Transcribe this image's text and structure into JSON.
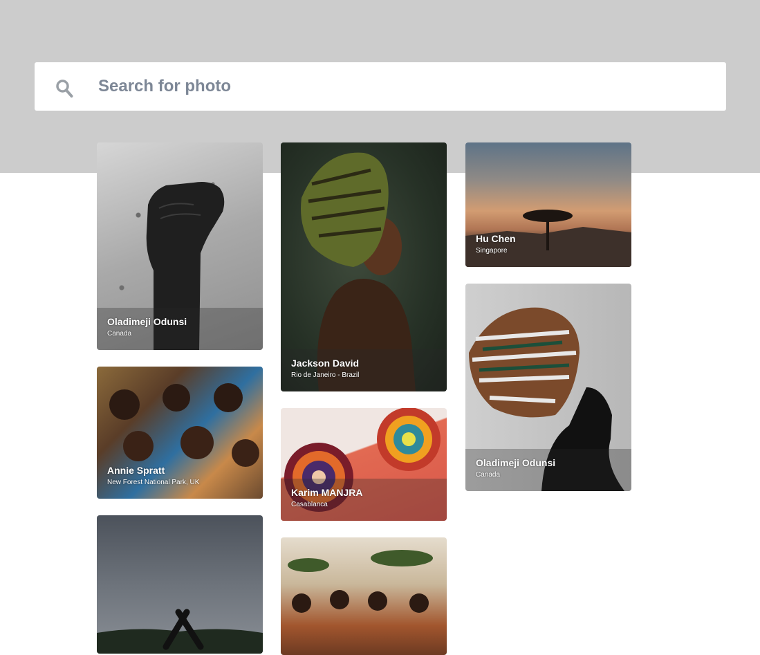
{
  "search": {
    "placeholder": "Search for photo",
    "icon": "search-icon"
  },
  "colors": {
    "header_band": "#cccccc",
    "search_text": "#7d8796",
    "caption_overlay": "rgba(40,40,40,0.30)"
  },
  "photos": [
    {
      "name": "Oladimeji Odunsi",
      "location": "Canada",
      "subject": "raised fist"
    },
    {
      "name": "Jackson David",
      "location": "Rio de Janeiro - Brazil",
      "subject": "woman in headwrap"
    },
    {
      "name": "Hu Chen",
      "location": "Singapore",
      "subject": "savanna sunset tree"
    },
    {
      "name": "Annie Spratt",
      "location": "New Forest National Park, UK",
      "subject": "group of children"
    },
    {
      "name": "Oladimeji Odunsi",
      "location": "Canada",
      "subject": "woman profile headwrap"
    },
    {
      "name": "Karim MANJRA",
      "location": "Casablanca",
      "subject": "woven baskets"
    },
    {
      "name": "",
      "location": "",
      "subject": "crossed arms against sky"
    },
    {
      "name": "",
      "location": "",
      "subject": "dancers in savanna"
    }
  ]
}
